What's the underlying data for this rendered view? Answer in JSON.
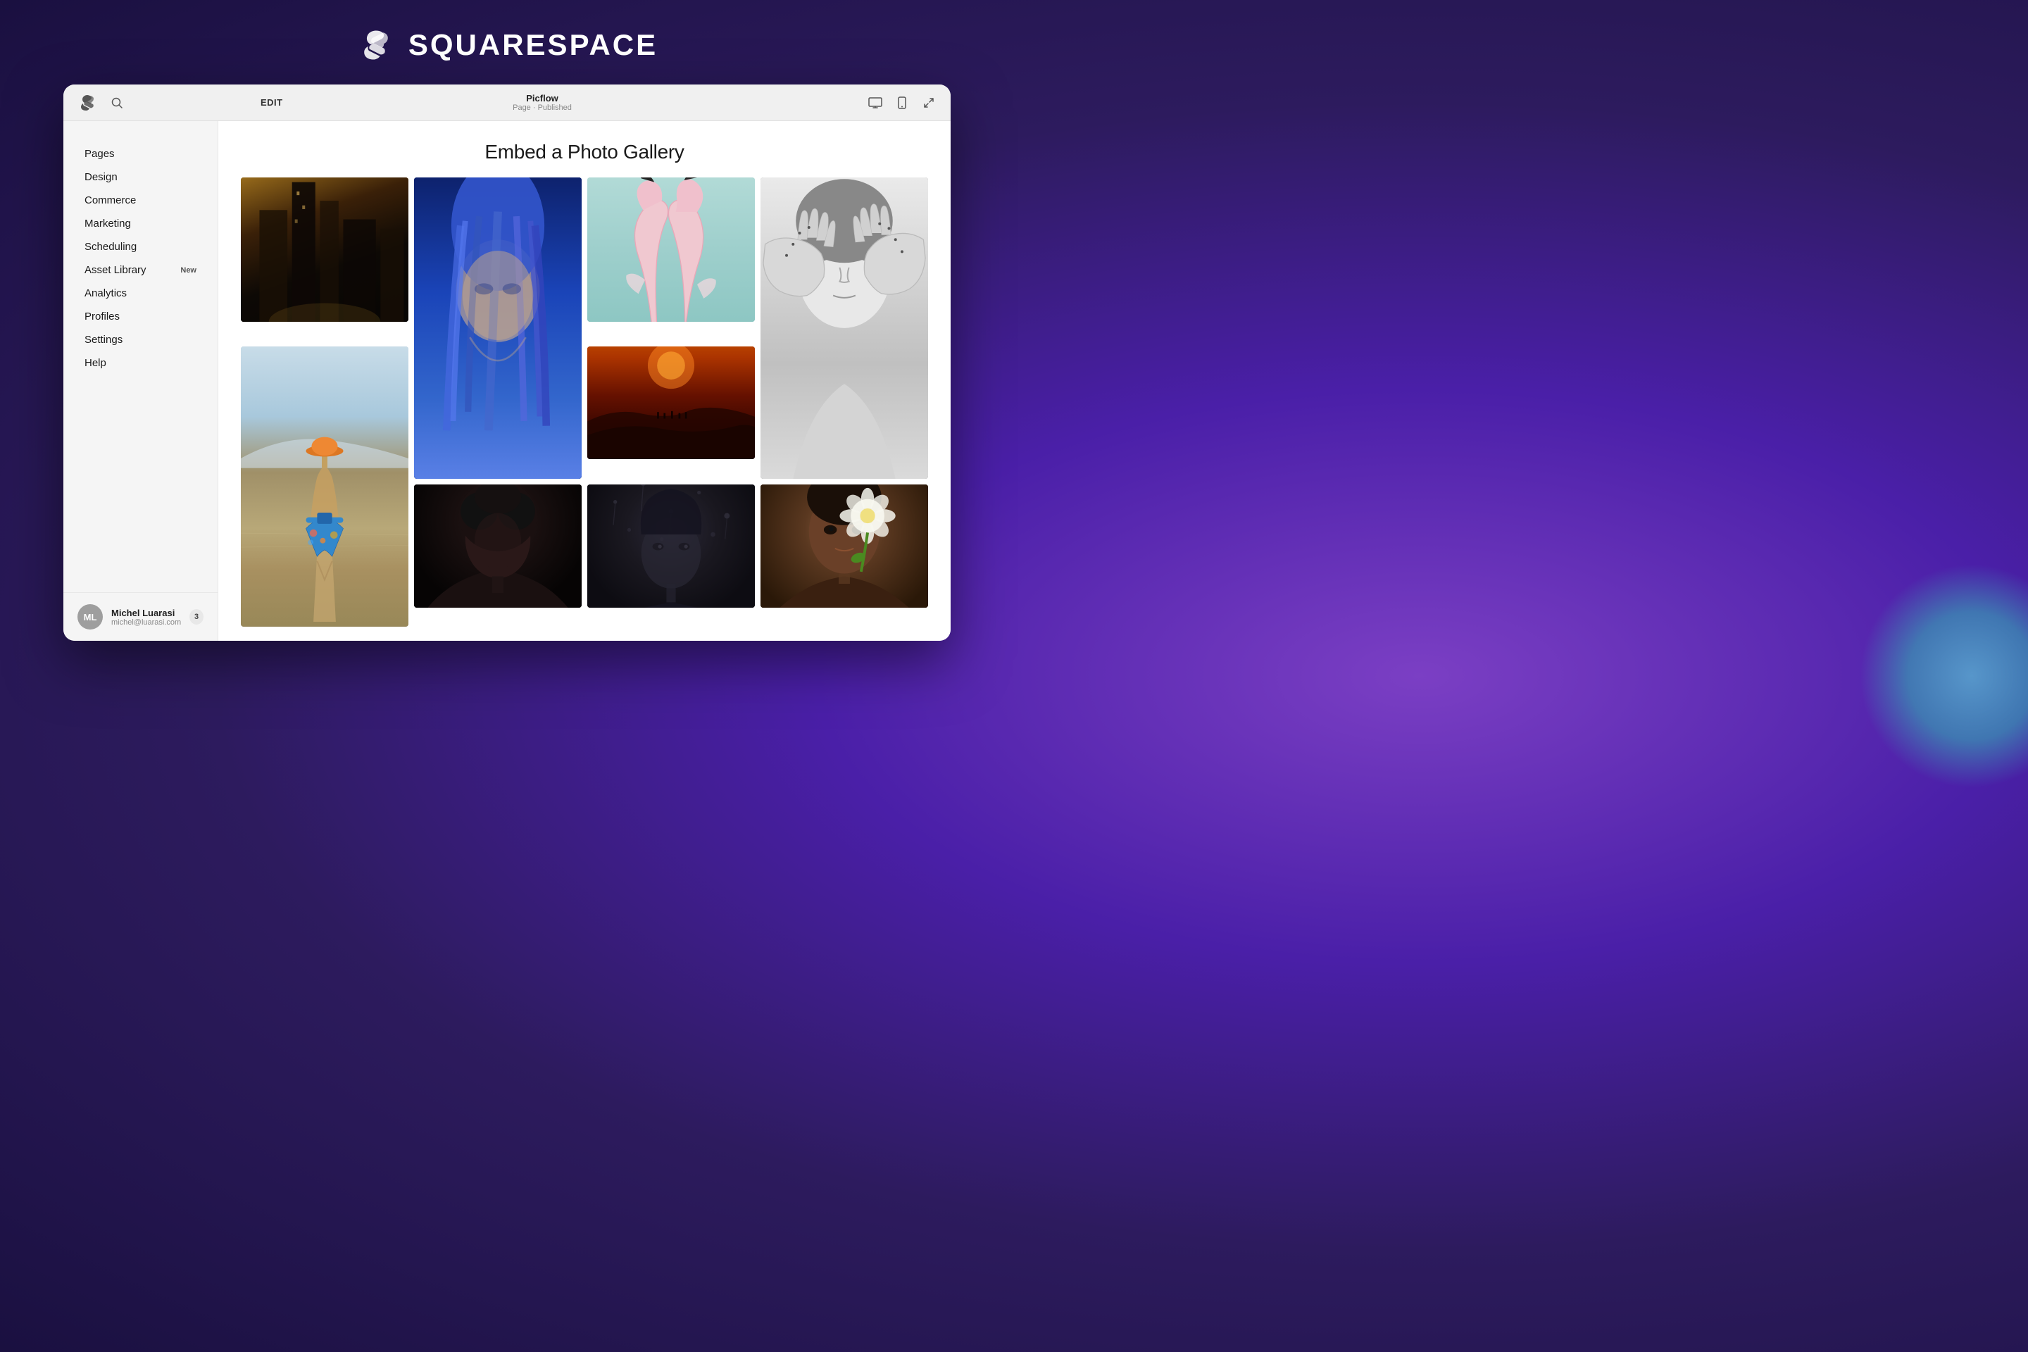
{
  "background": {
    "primaryColor": "#2d1b5e",
    "accentColor": "#7b3fc4"
  },
  "header": {
    "brand": "SQUARESPACE"
  },
  "topbar": {
    "editLabel": "EDIT",
    "siteName": "Picflow",
    "siteStatus": "Page · Published",
    "desktopIcon": "desktop",
    "mobileIcon": "mobile",
    "expandIcon": "expand"
  },
  "sidebar": {
    "navItems": [
      {
        "label": "Pages",
        "badge": ""
      },
      {
        "label": "Design",
        "badge": ""
      },
      {
        "label": "Commerce",
        "badge": ""
      },
      {
        "label": "Marketing",
        "badge": ""
      },
      {
        "label": "Scheduling",
        "badge": ""
      },
      {
        "label": "Asset Library",
        "badge": "New"
      },
      {
        "label": "Analytics",
        "badge": ""
      },
      {
        "label": "Profiles",
        "badge": ""
      },
      {
        "label": "Settings",
        "badge": ""
      },
      {
        "label": "Help",
        "badge": ""
      }
    ],
    "user": {
      "initials": "ML",
      "name": "Michel Luarasi",
      "email": "michel@luarasi.com",
      "notifCount": "3"
    }
  },
  "content": {
    "pageTitle": "Embed a Photo Gallery"
  }
}
